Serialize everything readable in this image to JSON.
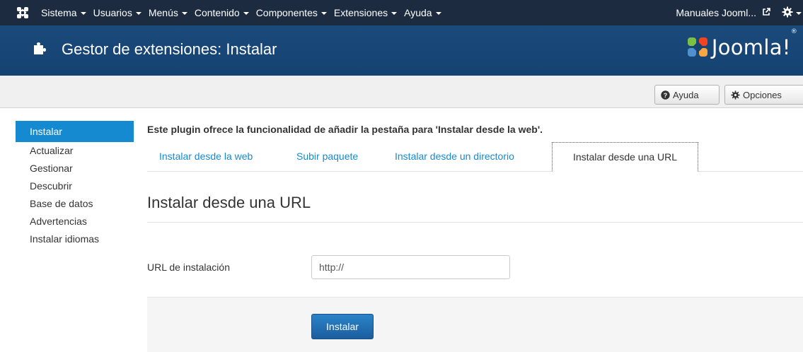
{
  "navbar": {
    "logo_icon": "joomla-icon",
    "menu": [
      {
        "label": "Sistema"
      },
      {
        "label": "Usuarios"
      },
      {
        "label": "Menús"
      },
      {
        "label": "Contenido"
      },
      {
        "label": "Componentes"
      },
      {
        "label": "Extensiones"
      },
      {
        "label": "Ayuda"
      }
    ],
    "site_link": "Manuales Jooml...",
    "site_link_icon": "external-link-icon",
    "user_menu_icon": "gear-icon"
  },
  "header": {
    "icon": "puzzle-icon",
    "title": "Gestor de extensiones: Instalar",
    "brand": "Joomla!",
    "brand_reg": "®",
    "brand_colors": [
      "#f9a541",
      "#f44321",
      "#5091cd",
      "#7ac143"
    ]
  },
  "toolbar": {
    "help_label": "Ayuda",
    "help_icon": "question-circle-icon",
    "options_label": "Opciones",
    "options_icon": "gear-icon"
  },
  "sidebar": {
    "items": [
      {
        "label": "Instalar",
        "active": true
      },
      {
        "label": "Actualizar"
      },
      {
        "label": "Gestionar"
      },
      {
        "label": "Descubrir"
      },
      {
        "label": "Base de datos"
      },
      {
        "label": "Advertencias"
      },
      {
        "label": "Instalar idiomas"
      }
    ]
  },
  "main": {
    "plugin_message": "Este plugin ofrece la funcionalidad de añadir la pestaña para 'Instalar desde la web'.",
    "tabs": [
      {
        "label": "Instalar desde la web"
      },
      {
        "label": "Subir paquete"
      },
      {
        "label": "Instalar desde un directorio"
      },
      {
        "label": "Instalar desde una URL",
        "active": true
      }
    ],
    "section_title": "Instalar desde una URL",
    "url_label": "URL de instalación",
    "url_value": "http://",
    "install_button": "Instalar"
  },
  "colors": {
    "navbar_bg": "#1c2b40",
    "header_bg": "#154271",
    "accent": "#168ad0",
    "primary_button": "#2a84c8"
  }
}
